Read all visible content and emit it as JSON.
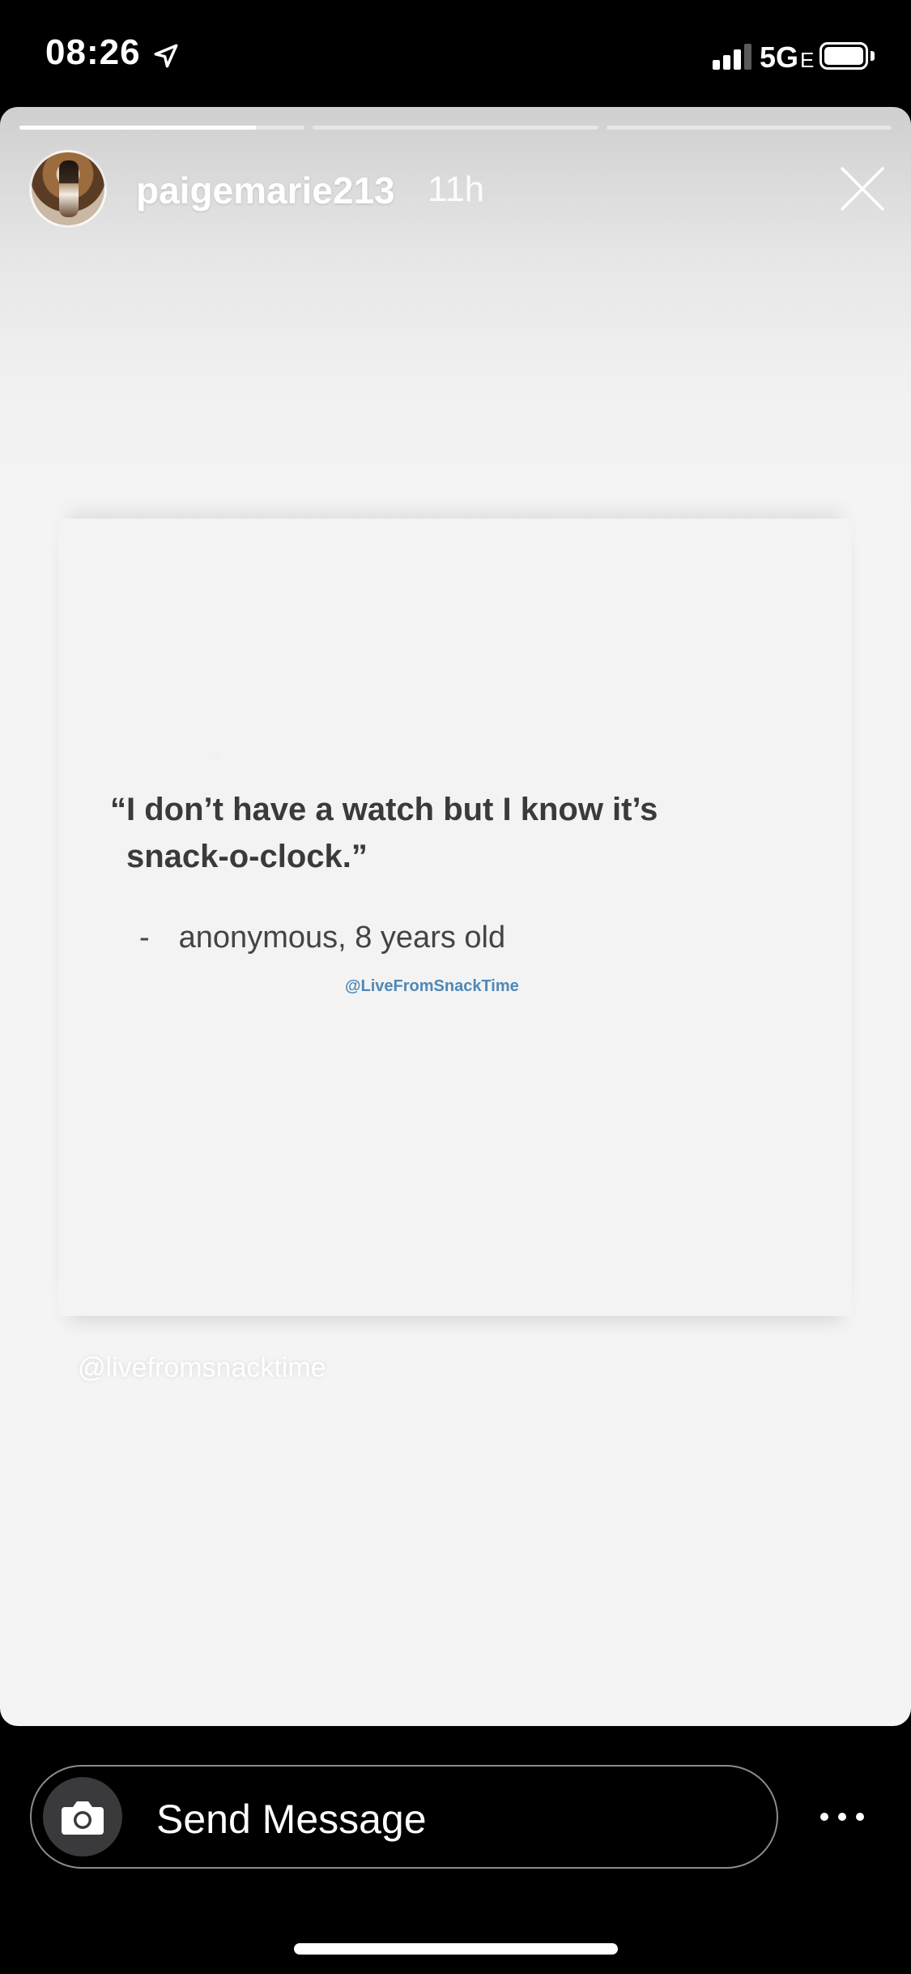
{
  "status_bar": {
    "time": "08:26",
    "network": "5G",
    "network_suffix": "E",
    "icons": [
      "location-arrow-icon",
      "signal-icon",
      "battery-icon"
    ]
  },
  "story": {
    "username": "paigemarie213",
    "age": "11h",
    "progress": {
      "segment_count": 3,
      "current_segment": 1,
      "current_segment_fill": 0.83
    },
    "quote": {
      "line1": "“I don’t have a watch but I know it’s",
      "line2": "snack-o-clock.”",
      "dash": "-",
      "attribution": "anonymous, 8 years old",
      "source": "@LiveFromSnackTime"
    },
    "repost_handle": "@livefromsnacktime",
    "icons": [
      "avatar",
      "close-icon"
    ]
  },
  "reply_bar": {
    "placeholder": "Send Message",
    "icons": [
      "camera-icon",
      "more-icon"
    ]
  },
  "colors": {
    "background": "#000000",
    "card_top": "#cfcfcf",
    "card": "#f4f4f4",
    "quote_text": "#3a3a3a",
    "source_link": "#4f88b6",
    "camera_button": "#3a3a3c"
  }
}
